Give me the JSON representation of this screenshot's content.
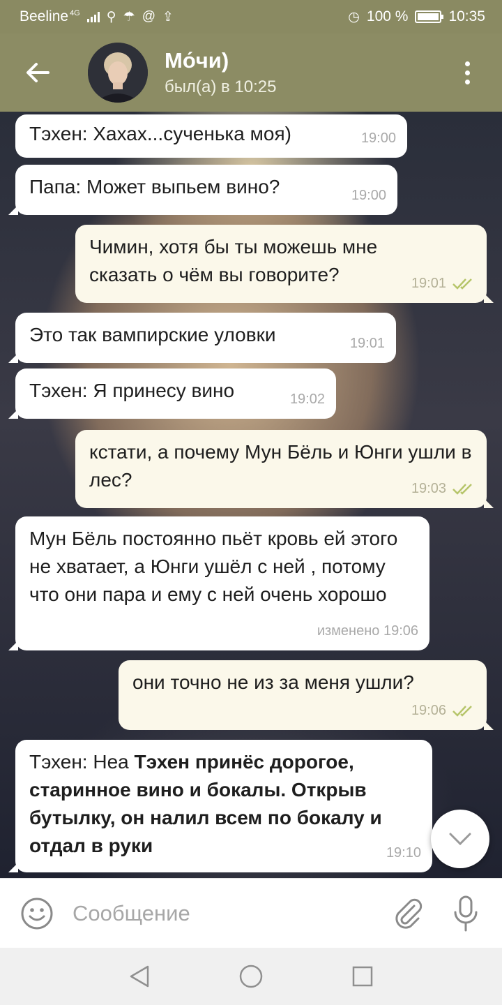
{
  "status_bar": {
    "carrier": "Beeline",
    "network": "4G",
    "battery": "100 %",
    "time": "10:35"
  },
  "header": {
    "name": "Мо́чи)",
    "status": "был(а) в 10:25"
  },
  "messages": [
    {
      "direction": "in",
      "text": "Тэхен: Хахах...сученька моя)",
      "time": "19:00"
    },
    {
      "direction": "in",
      "text": "Папа: Может выпьем вино?",
      "time": "19:00"
    },
    {
      "direction": "out",
      "text": "Чимин, хотя бы ты можешь мне сказать о чём вы говорите?",
      "time": "19:01"
    },
    {
      "direction": "in",
      "text": "Это так вампирские уловки",
      "time": "19:01"
    },
    {
      "direction": "in",
      "text": "Тэхен: Я принесу вино",
      "time": "19:02"
    },
    {
      "direction": "out",
      "text": "кстати, а почему Мун Бёль и Юнги ушли в лес?",
      "time": "19:03"
    },
    {
      "direction": "in",
      "text": "Мун Бёль постоянно пьёт кровь ей этого не хватает, а Юнги ушёл с ней , потому что они пара и ему с ней очень хорошо",
      "time": "изменено 19:06"
    },
    {
      "direction": "out",
      "text": "они точно не из за меня ушли?",
      "time": "19:06"
    },
    {
      "direction": "in",
      "text_prefix": "Тэхен: Неа ",
      "text_bold": "Тэхен принёс дорогое, старинное вино и бокалы. Открыв бутылку, он налил всем по бокалу и отдал в руки",
      "time": "19:10"
    }
  ],
  "composer": {
    "placeholder": "Сообщение"
  },
  "colors": {
    "header": "#8c8c64",
    "incoming_bubble": "#ffffff",
    "outgoing_bubble": "#fbf8ea",
    "read_check": "#b6c56a"
  },
  "icons": [
    "back-arrow-icon",
    "more-vert-icon",
    "emoji-icon",
    "attach-icon",
    "mic-icon",
    "chevron-down-icon",
    "nav-back-icon",
    "nav-home-icon",
    "nav-recents-icon"
  ]
}
